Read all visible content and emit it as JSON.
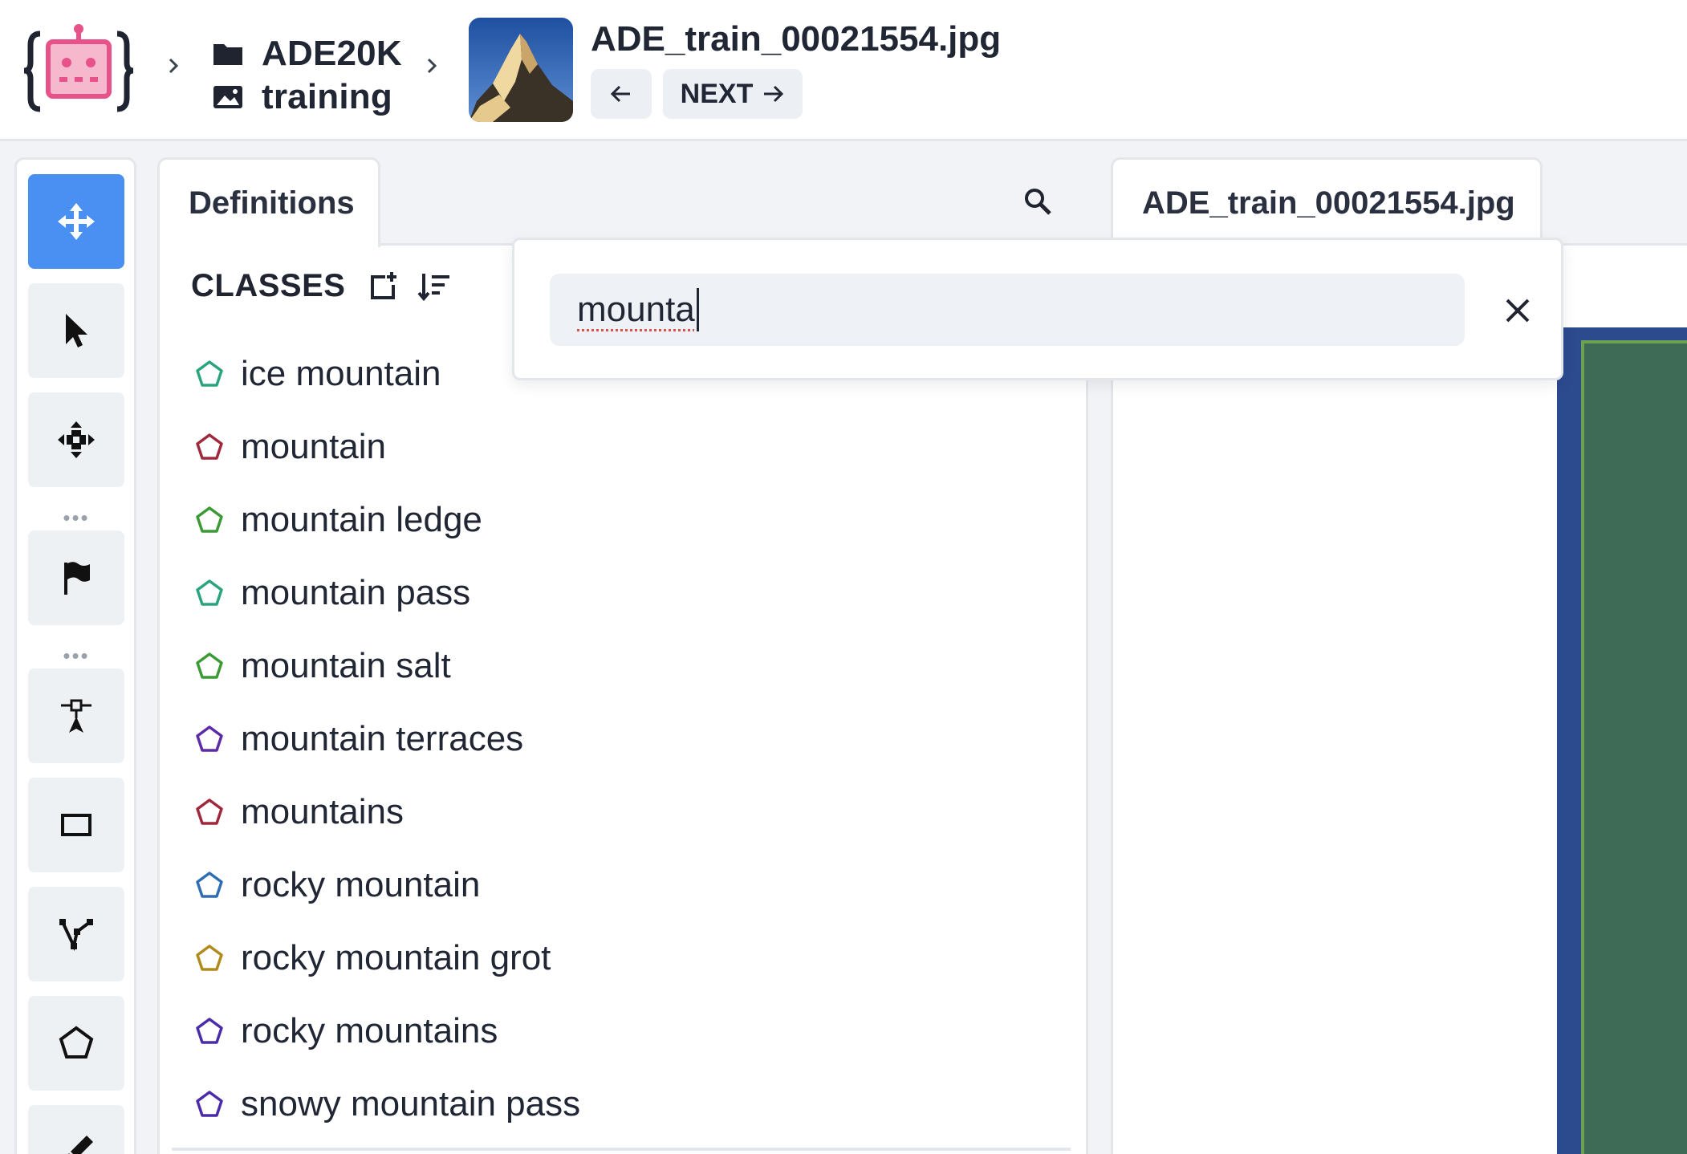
{
  "header": {
    "dataset": "ADE20K",
    "split": "training",
    "file_name": "ADE_train_00021554.jpg",
    "next_label": "NEXT",
    "icons": {
      "logo": "robot-logo-icon",
      "breadcrumb_separator": "chevron-right-icon",
      "dataset": "folder-icon",
      "split": "image-icon",
      "prev": "arrow-left-icon",
      "next": "arrow-right-icon"
    }
  },
  "toolbar": {
    "tools": [
      "pan",
      "select",
      "move-points",
      "flag",
      "keypoint",
      "rectangle",
      "polyline",
      "polygon",
      "brush"
    ],
    "active_tool": "pan",
    "active_color": "#4a90f2"
  },
  "definitions": {
    "tab_label": "Definitions",
    "classes_title": "CLASSES",
    "classes": [
      {
        "label": "ice mountain",
        "color": "#2aa37f"
      },
      {
        "label": "mountain",
        "color": "#a0283d"
      },
      {
        "label": "mountain ledge",
        "color": "#3a9a33"
      },
      {
        "label": "mountain pass",
        "color": "#2aa37f"
      },
      {
        "label": "mountain salt",
        "color": "#3a9a33"
      },
      {
        "label": "mountain terraces",
        "color": "#5d2aa8"
      },
      {
        "label": "mountains",
        "color": "#a0283d"
      },
      {
        "label": "rocky mountain",
        "color": "#2f6db3"
      },
      {
        "label": "rocky mountain grot",
        "color": "#b08a1a"
      },
      {
        "label": "rocky mountains",
        "color": "#4a2ba8"
      },
      {
        "label": "snowy mountain pass",
        "color": "#4a2ba8"
      }
    ]
  },
  "image_panel": {
    "tab_label": "ADE_train_00021554.jpg"
  },
  "search": {
    "query": "mounta",
    "icons": {
      "search": "search-icon",
      "clear": "close-icon"
    }
  }
}
